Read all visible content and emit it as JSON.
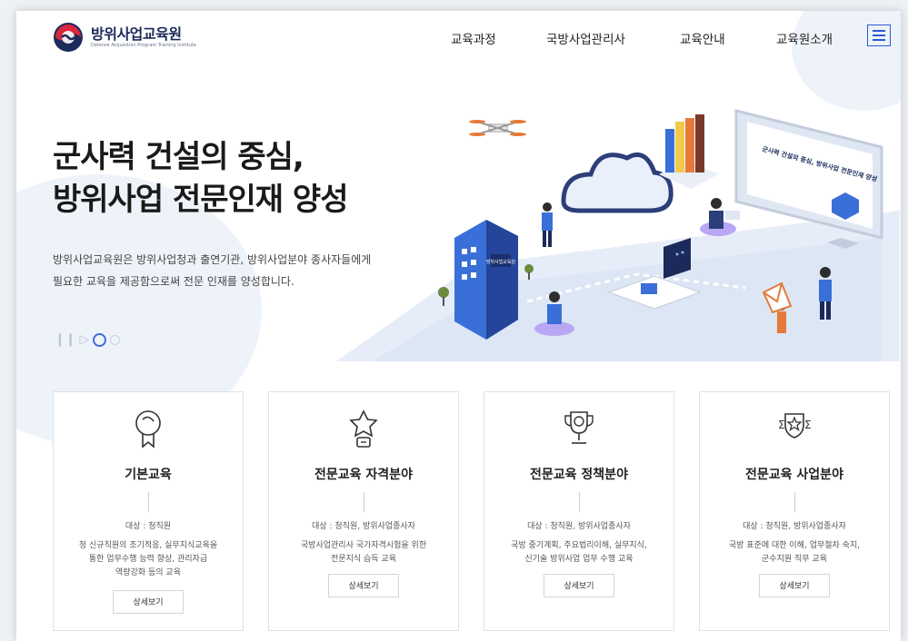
{
  "header": {
    "logo_name": "방위사업교육원",
    "logo_sub": "Defense Acquisition Program Training Institute",
    "nav": [
      "교육과정",
      "국방사업관리사",
      "교육안내",
      "교육원소개"
    ],
    "menu_icon": "hamburger-menu-icon"
  },
  "hero": {
    "title_line1": "군사력 건설의 중심,",
    "title_line2": "방위사업 전문인재 양성",
    "desc_line1": "방위사업교육원은 방위사업청과 출연기관, 방위사업분야 종사자들에게",
    "desc_line2": "필요한 교육을 제공함으로써 전문 인재를 양성합니다.",
    "illustration_screen_text": "군사력 건설의 중심, 방위사업 전문인재 양성",
    "illustration_building_sign": "방위사업교육원",
    "slider": {
      "pause_icon": "pause-icon",
      "play_icon": "play-icon",
      "slides": 2,
      "active": 1
    }
  },
  "cards": [
    {
      "icon": "medal-icon",
      "title": "기본교육",
      "target": "대상 : 청직원",
      "desc": [
        "청 신규직원의 조기적응, 실무지식교육을",
        "통한 업무수행 능력 향상, 관리자급",
        "역량강화 등의 교육"
      ],
      "button": "상세보기"
    },
    {
      "icon": "star-badge-icon",
      "title": "전문교육 자격분야",
      "target": "대상 : 청직원, 방위사업종사자",
      "desc": [
        "국방사업관리사 국가자격시험을 위한",
        "전문지식 습득 교육"
      ],
      "button": "상세보기"
    },
    {
      "icon": "trophy-icon",
      "title": "전문교육 정책분야",
      "target": "대상 : 청직원, 방위사업종사자",
      "desc": [
        "국방 중기계획, 주요법리이해, 실무지식,",
        "신기술 방위사업 업무 수행 교육"
      ],
      "button": "상세보기"
    },
    {
      "icon": "shield-star-icon",
      "title": "전문교육 사업분야",
      "target": "대상 : 청직원, 방위사업종사자",
      "desc": [
        "국방 표준에 대한 이해, 업무절차 숙지,",
        "군수지원 직무 교육"
      ],
      "button": "상세보기"
    }
  ],
  "colors": {
    "accent": "#2a5bd7",
    "navy": "#1b2a5a",
    "sky": "#dfe7f3"
  }
}
